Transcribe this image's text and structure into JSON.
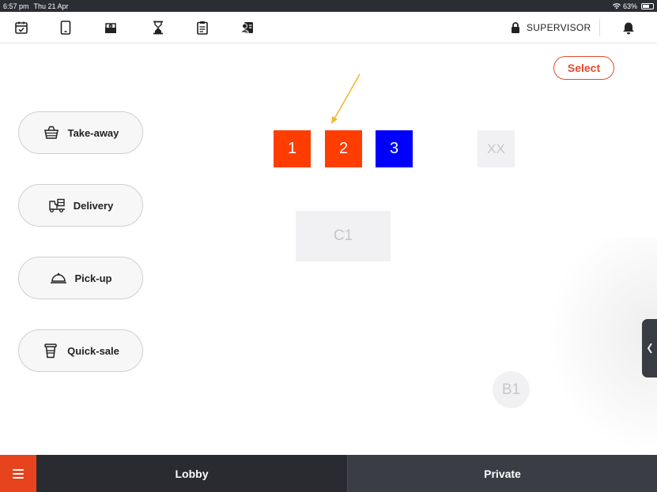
{
  "status_bar": {
    "time": "6:57 pm",
    "date": "Thu 21 Apr",
    "battery": "63%",
    "battery_level": 0.63
  },
  "toolbar": {
    "icons": [
      "calendar-check-icon",
      "tablet-icon",
      "cash-drawer-icon",
      "hourglass-icon",
      "clipboard-icon",
      "user-card-icon"
    ],
    "role_label": "SUPERVISOR"
  },
  "select_label": "Select",
  "order_types": [
    {
      "label": "Take-away",
      "icon": "basket-icon"
    },
    {
      "label": "Delivery",
      "icon": "delivery-icon"
    },
    {
      "label": "Pick-up",
      "icon": "cloche-icon"
    },
    {
      "label": "Quick-sale",
      "icon": "cup-icon"
    }
  ],
  "tables": [
    {
      "label": "1",
      "color": "#ff3d00"
    },
    {
      "label": "2",
      "color": "#ff3d00"
    },
    {
      "label": "3",
      "color": "#0000ff"
    },
    {
      "label": "XX",
      "color": "#f1f1f3"
    },
    {
      "label": "C1",
      "color": "#f1f1f3"
    },
    {
      "label": "B1",
      "color": "#f1f1f3"
    }
  ],
  "bottom_tabs": {
    "lobby": "Lobby",
    "private": "Private"
  },
  "colors": {
    "accent": "#e8492b",
    "arrow": "#f5b82e",
    "dark": "#2a2b31"
  }
}
